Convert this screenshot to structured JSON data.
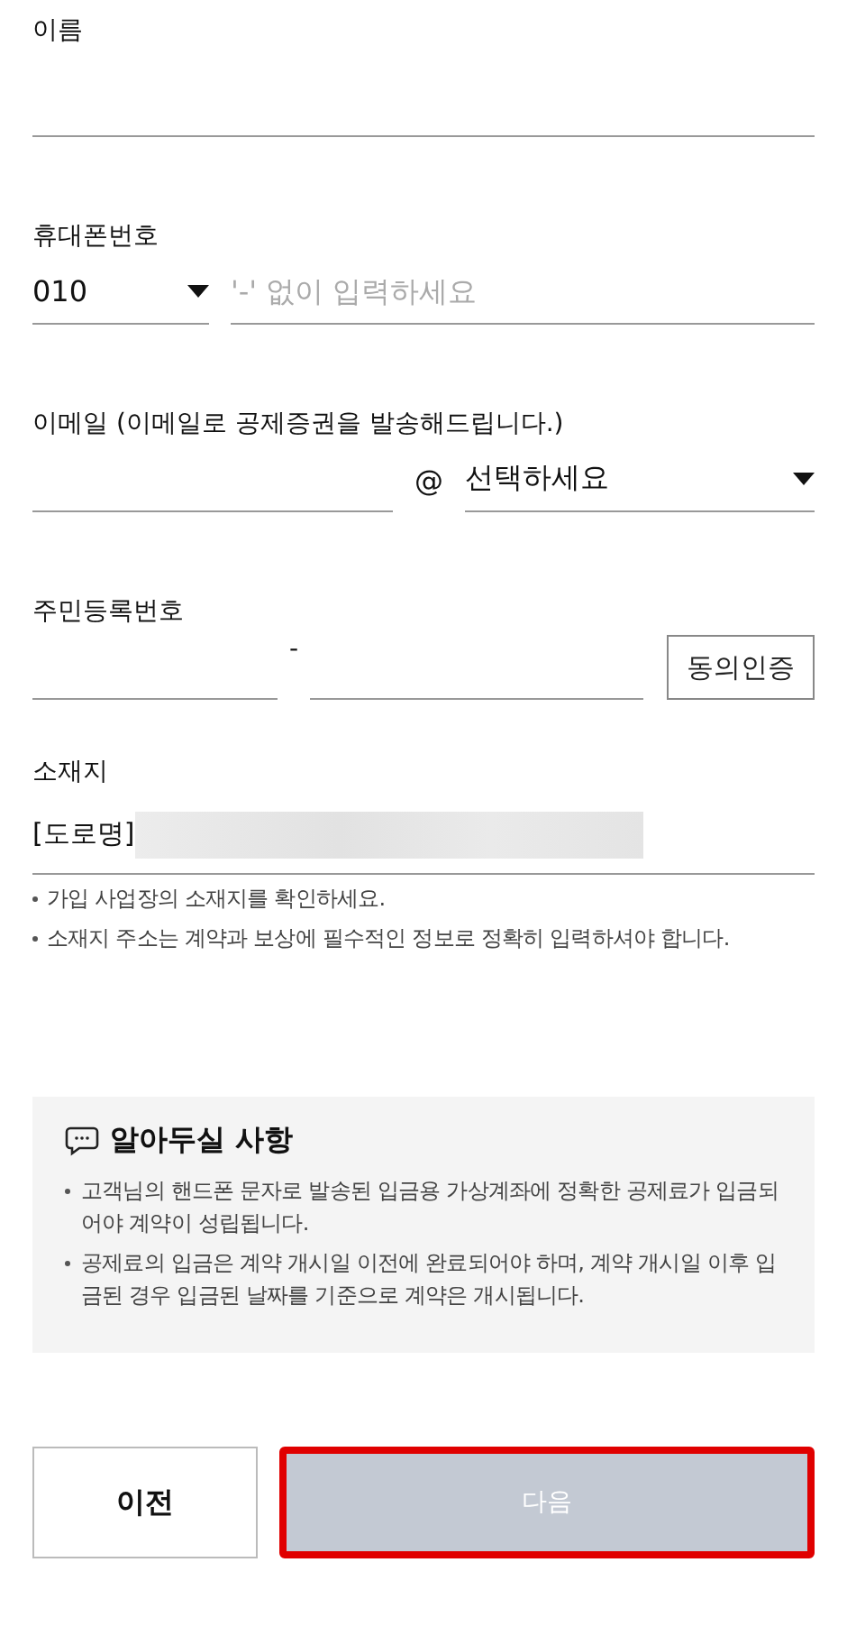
{
  "name_field": {
    "label": "이름"
  },
  "phone": {
    "label": "휴대폰번호",
    "prefix": "010",
    "placeholder": "'-' 없이 입력하세요"
  },
  "email": {
    "label": "이메일 (이메일로 공제증권을 발송해드립니다.)",
    "at": "@",
    "domain_placeholder": "선택하세요"
  },
  "rrn": {
    "label": "주민등록번호",
    "separator": "-",
    "button": "동의인증"
  },
  "address": {
    "label": "소재지",
    "value": "[도로명]",
    "redacted": true,
    "notes": [
      "가입 사업장의 소재지를 확인하세요.",
      "소재지 주소는 계약과 보상에 필수적인 정보로 정확히 입력하셔야 합니다."
    ]
  },
  "notice": {
    "title": "알아두실 사항",
    "items": [
      "고객님의 핸드폰 문자로 발송된 입금용 가상계좌에 정확한 공제료가 입금되어야 계약이 성립됩니다.",
      "공제료의 입금은 계약 개시일 이전에 완료되어야 하며, 계약 개시일 이후 입금된 경우 입금된 날짜를 기준으로 계약은 개시됩니다."
    ]
  },
  "buttons": [
    {
      "label": "이전",
      "disabled": false,
      "highlighted": false
    },
    {
      "label": "다음",
      "disabled": true,
      "highlighted": true
    }
  ]
}
